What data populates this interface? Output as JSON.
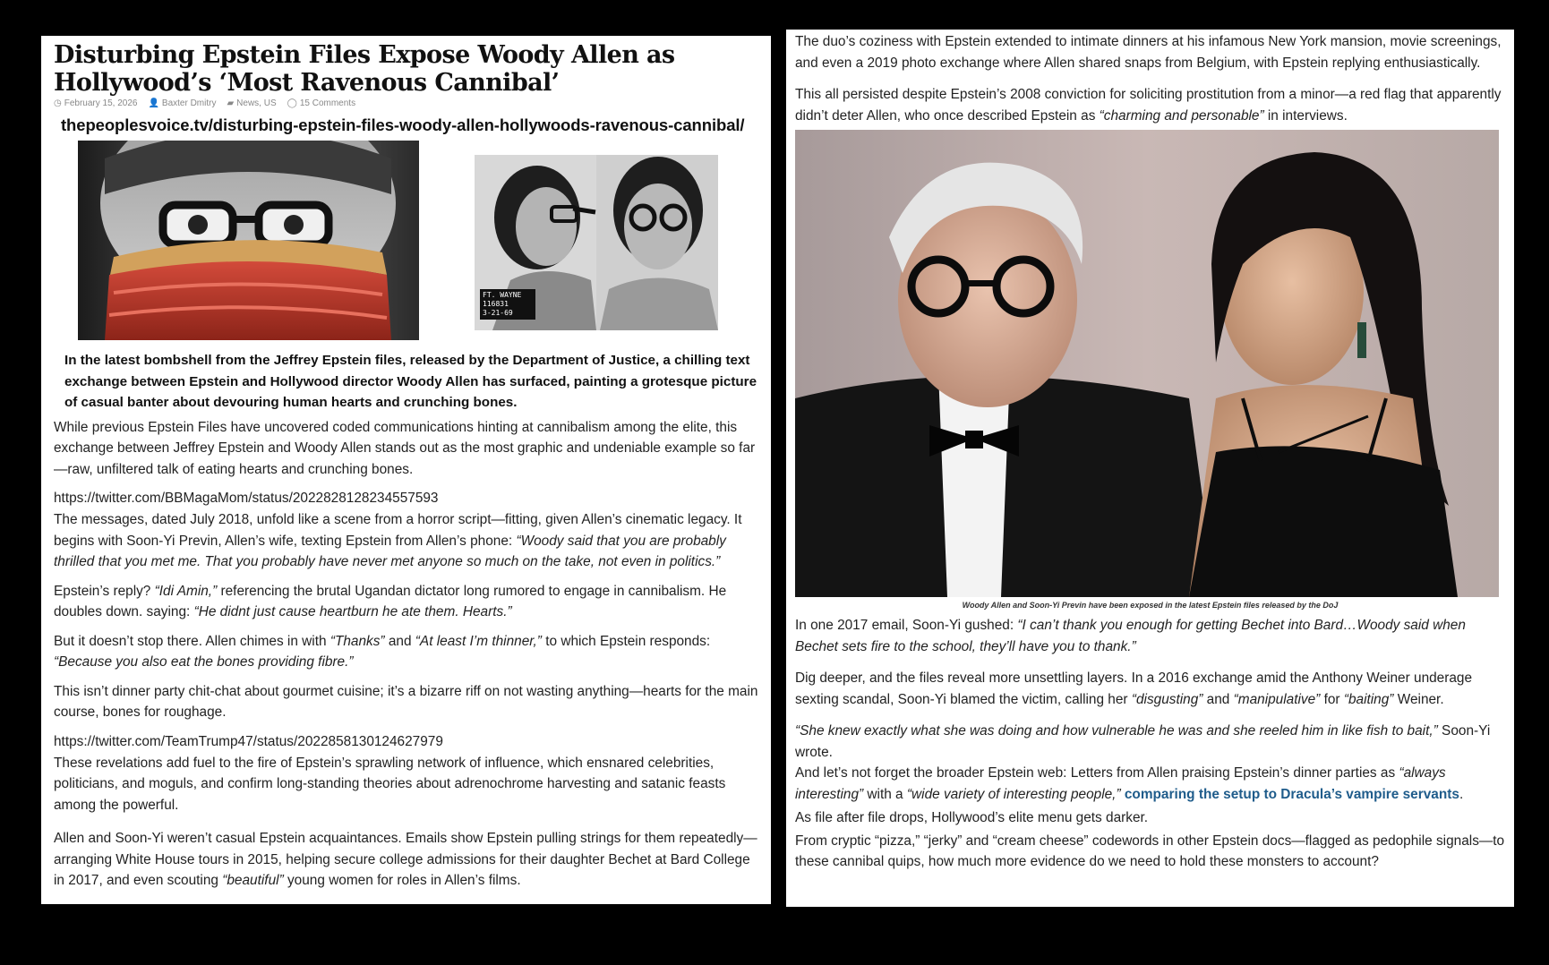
{
  "article": {
    "title": "Disturbing Epstein Files Expose Woody Allen as Hollywood’s ‘Most Ravenous Cannibal’",
    "date": "February 15, 2026",
    "author": "Baxter Dmitry",
    "categories": "News, US",
    "comments": "15 Comments",
    "url": "thepeoplesvoice.tv/disturbing-epstein-files-woody-allen-hollywoods-ravenous-cannibal/",
    "mugshot_sign_lines": [
      "FT. WAYNE",
      "116831",
      "3-21-69"
    ],
    "lead": "In the latest bombshell from the Jeffrey Epstein files, released by the Department of Justice, a chilling text exchange between Epstein and Hollywood director Woody Allen has surfaced, painting a grotesque picture of casual banter about devouring human hearts and crunching bones.",
    "p1": "While previous Epstein Files have uncovered coded communications hinting at cannibalism among the elite, this exchange between Jeffrey Epstein and Woody Allen stands out as the most graphic and undeniable example so far—raw, unfiltered talk of eating hearts and crunching bones.",
    "tweet1": "https://twitter.com/BBMagaMom/status/2022828128234557593",
    "p2_text": "The messages, dated July 2018, unfold like a scene from a horror script—fitting, given Allen’s cinematic legacy. It begins with Soon-Yi Previn, Allen’s wife, texting Epstein from Allen’s phone: ",
    "p2_quote": "“Woody said that you are probably thrilled that you met me. That you probably have never met anyone so much on the take, not even in politics.”",
    "p3_a": "Epstein’s reply? ",
    "p3_q1": "“Idi Amin,”",
    "p3_b": " referencing the brutal Ugandan dictator long rumored to engage in cannibalism. He doubles down. saying: ",
    "p3_q2": "“He didnt just cause heartburn he ate them. Hearts.”",
    "p4_a": "But it doesn’t stop there. Allen chimes in with ",
    "p4_q1": "“Thanks”",
    "p4_b": " and ",
    "p4_q2": "“At least I’m thinner,”",
    "p4_c": " to which Epstein responds: ",
    "p4_q3": "“Because you also eat the bones providing fibre.”",
    "p5": "This isn’t dinner party chit-chat about gourmet cuisine; it’s a bizarre riff on not wasting anything—hearts for the main course, bones for roughage.",
    "tweet2": "https://twitter.com/TeamTrump47/status/2022858130124627979",
    "p6": "These revelations add fuel to the fire of Epstein’s sprawling network of influence, which ensnared celebrities, politicians, and moguls, and confirm long-standing theories about adrenochrome harvesting and satanic feasts among the powerful.",
    "p7_a": "Allen and Soon-Yi weren’t casual Epstein acquaintances. Emails show Epstein pulling strings for them repeatedly—arranging White House tours in 2015, helping secure college admissions for their daughter Bechet at Bard College in 2017, and even scouting ",
    "p7_q": "“beautiful”",
    "p7_b": " young women for roles in Allen’s films."
  },
  "right": {
    "r1": "The duo’s coziness with Epstein extended to intimate dinners at his infamous New York mansion, movie screenings, and even a 2019 photo exchange where Allen shared snaps from Belgium, with Epstein replying enthusiastically.",
    "r2_a": "This all persisted despite Epstein’s 2008 conviction for soliciting prostitution from a minor—a red flag that apparently didn’t deter Allen, who once described Epstein as ",
    "r2_q": "“charming and personable”",
    "r2_b": " in interviews.",
    "caption": "Woody Allen and Soon-Yi Previn have been exposed in the latest Epstein files released by the DoJ",
    "r3_a": "In one 2017 email, Soon-Yi gushed: ",
    "r3_q": "“I can’t thank you enough for getting Bechet into Bard…Woody said when Bechet sets fire to the school, they’ll have you to thank.”",
    "r4_a": "Dig deeper, and the files reveal more unsettling layers. In a 2016 exchange amid the Anthony Weiner underage sexting scandal, Soon-Yi blamed the victim, calling her ",
    "r4_q1": "“disgusting”",
    "r4_b": " and ",
    "r4_q2": "“manipulative”",
    "r4_c": " for ",
    "r4_q3": "“baiting”",
    "r4_d": " Weiner.",
    "r5_q": "“She knew exactly what she was doing and how vulnerable he was and she reeled him in like fish to bait,”",
    "r5_b": " Soon-Yi wrote.",
    "r6_a": "And let’s not forget the broader Epstein web: Letters from Allen praising Epstein’s dinner parties as ",
    "r6_q1": "“always interesting”",
    "r6_b": " with a ",
    "r6_q2": "“wide variety of interesting people,”",
    "r6_link": "comparing the setup to Dracula’s vampire servants",
    "r6_c": ".",
    "r7": "As file after file drops, Hollywood’s elite menu gets darker.",
    "r8": "From cryptic “pizza,” “jerky” and “cream cheese” codewords in other Epstein docs—flagged as pedophile signals—to these cannibal quips, how much more evidence do we need to hold these monsters to account?"
  },
  "colors": {
    "link": "#1f5c8b",
    "background": "#000000",
    "panel": "#ffffff"
  }
}
